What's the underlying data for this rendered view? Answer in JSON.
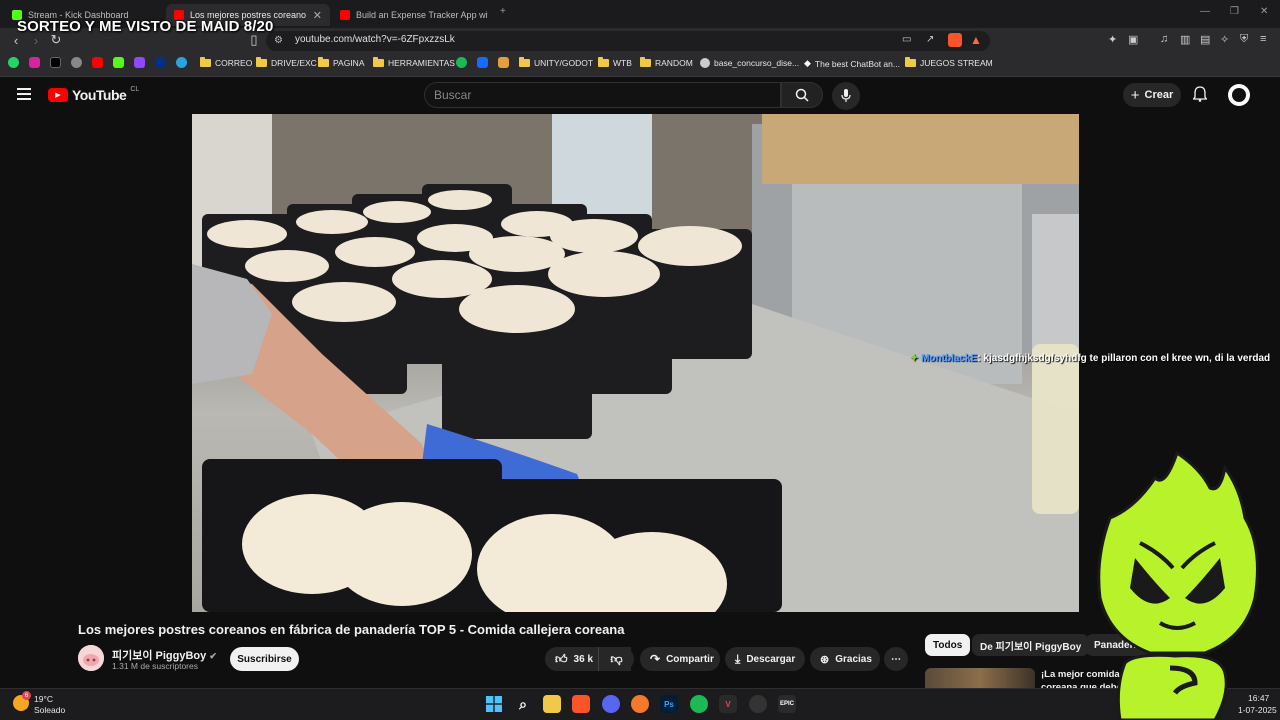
{
  "overlay": {
    "title": "SORTEO Y ME VISTO DE MAID 8/20"
  },
  "tabs": [
    {
      "label": "Stream - Kick Dashboard",
      "icon": "kick-icon"
    },
    {
      "label": "Los mejores postres coreano",
      "icon": "youtube-icon",
      "active": true
    },
    {
      "label": "Build an Expense Tracker App wit",
      "icon": "youtube-icon"
    }
  ],
  "address": {
    "url": "youtube.com/watch?v=-6ZFpxzzsLk"
  },
  "bookmarks": [
    "CORREO",
    "DRIVE/EXC",
    "PAGINA",
    "HERRAMIENTAS",
    "UNITY/GODOT",
    "WTB",
    "RANDOM",
    "base_concurso_dise...",
    "The best ChatBot an...",
    "JUEGOS STREAM"
  ],
  "youtube": {
    "logo": "YouTube",
    "region": "CL",
    "search_placeholder": "Buscar",
    "create_label": "Crear"
  },
  "chat": {
    "user": "MontblackE",
    "sep": ":",
    "message": "kjasdgfhjksdgfsyhdfg te pillaron con el kree wn, di la verdad"
  },
  "video": {
    "title": "Los mejores postres coreanos en fábrica de panadería TOP 5 - Comida callejera coreana",
    "channel": "피기보이 PiggyBoy",
    "subscribers": "1.31 M de suscriptores",
    "subscribe_label": "Suscribirse",
    "likes": "36 k",
    "share_label": "Compartir",
    "download_label": "Descargar",
    "thanks_label": "Gracias"
  },
  "chips": [
    "Todos",
    "De 피기보이 PiggyBoy",
    "Panadería"
  ],
  "related": {
    "title_line1": "¡La mejor comida cal",
    "title_line2": "coreana que debes"
  },
  "taskbar": {
    "weather_temp": "19°C",
    "weather_desc": "Soleado",
    "weather_badge": "6",
    "time": "16:47",
    "date": "1-07-2025"
  },
  "colors": {
    "youtube_red": "#ff0000",
    "mascot_green": "#b8f22a",
    "chat_user": "#5aa0ff"
  }
}
